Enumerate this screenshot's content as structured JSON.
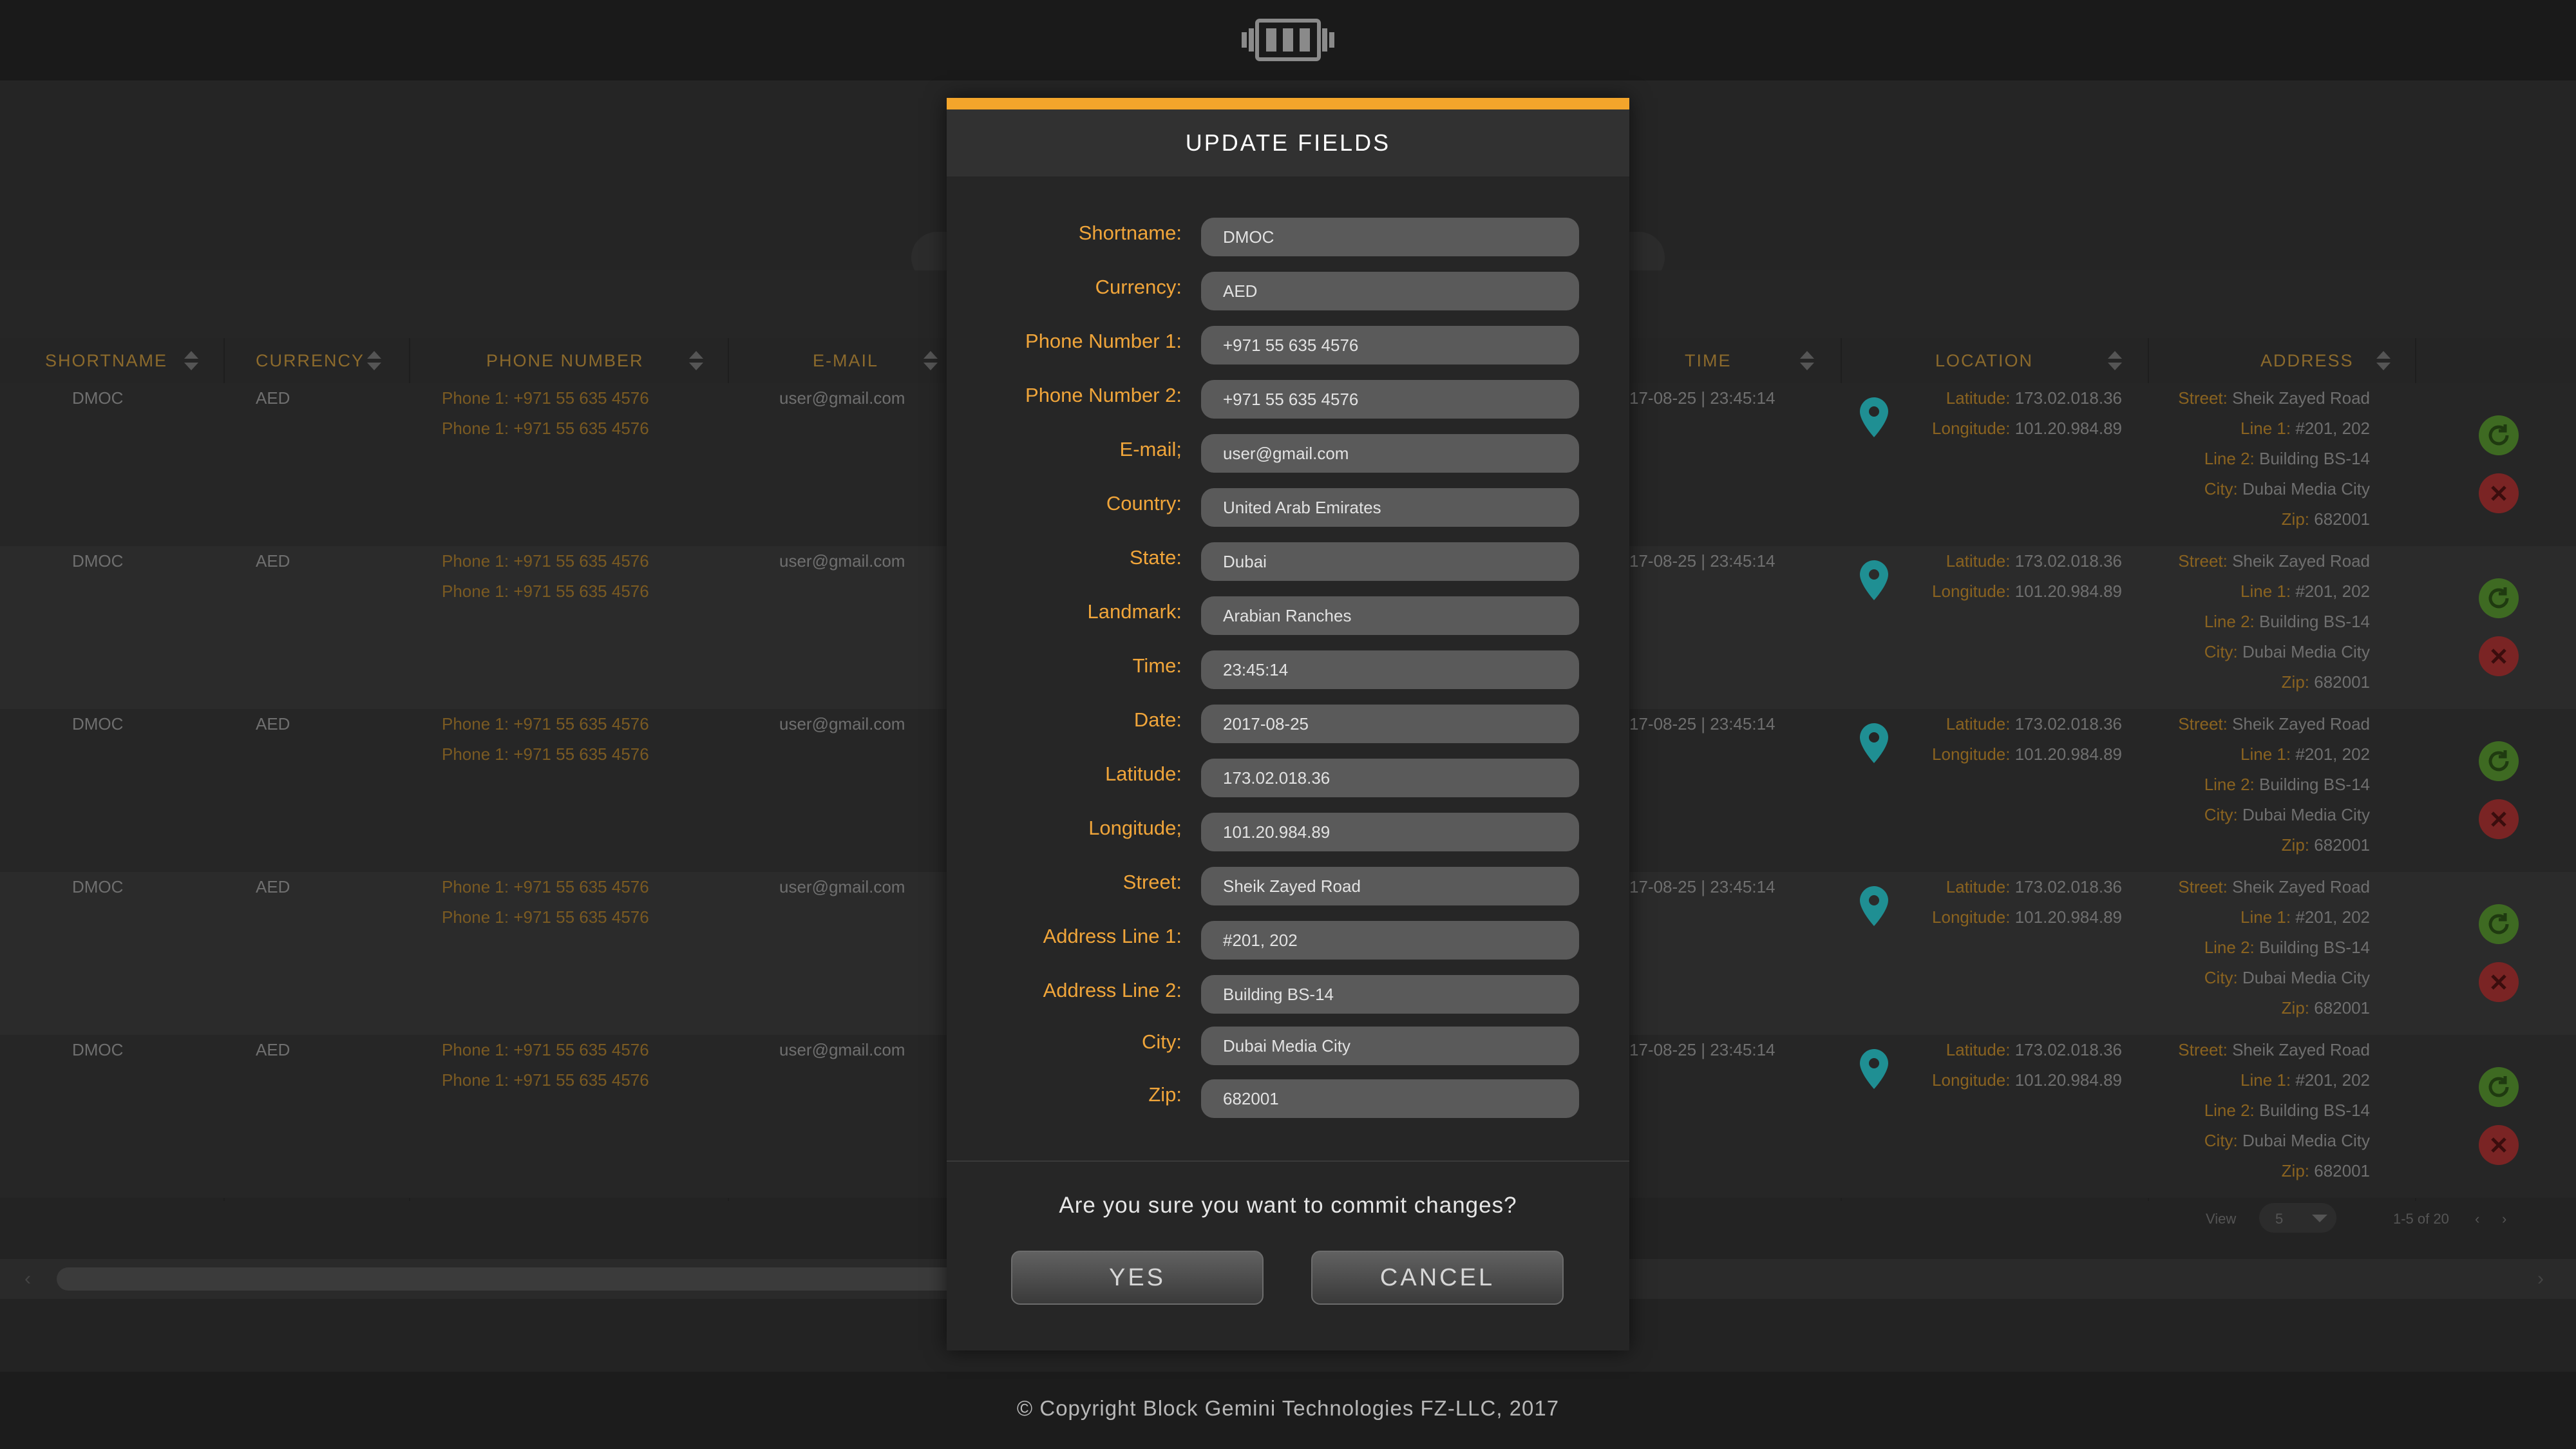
{
  "header": {
    "logo_icon": "block-gemini-logo-icon"
  },
  "table": {
    "columns": {
      "shortname": "SHORTNAME",
      "currency": "CURRENCY",
      "phone": "PHONE NUMBER",
      "email": "E-MAIL",
      "time": "TIME",
      "location": "LOCATION",
      "address": "ADDRESS"
    },
    "labels": {
      "phone1": "Phone 1:",
      "phone2": "Phone 1:",
      "latitude": "Latitude:",
      "longitude": "Longitude:",
      "street": "Street:",
      "line1": "Line 1:",
      "line2": "Line 2:",
      "city": "City:",
      "zip": "Zip:"
    },
    "rows": [
      {
        "shortname": "DMOC",
        "currency": "AED",
        "phone1": "+971 55 635 4576",
        "phone2": "+971 55 635 4576",
        "email": "user@gmail.com",
        "time": "17-08-25  |  23:45:14",
        "latitude": "173.02.018.36",
        "longitude": "101.20.984.89",
        "street": "Sheik Zayed Road",
        "line1": "#201, 202",
        "line2": "Building BS-14",
        "city": "Dubai Media City",
        "zip": "682001"
      },
      {
        "shortname": "DMOC",
        "currency": "AED",
        "phone1": "+971 55 635 4576",
        "phone2": "+971 55 635 4576",
        "email": "user@gmail.com",
        "time": "17-08-25  |  23:45:14",
        "latitude": "173.02.018.36",
        "longitude": "101.20.984.89",
        "street": "Sheik Zayed Road",
        "line1": "#201, 202",
        "line2": "Building BS-14",
        "city": "Dubai Media City",
        "zip": "682001"
      },
      {
        "shortname": "DMOC",
        "currency": "AED",
        "phone1": "+971 55 635 4576",
        "phone2": "+971 55 635 4576",
        "email": "user@gmail.com",
        "time": "17-08-25  |  23:45:14",
        "latitude": "173.02.018.36",
        "longitude": "101.20.984.89",
        "street": "Sheik Zayed Road",
        "line1": "#201, 202",
        "line2": "Building BS-14",
        "city": "Dubai Media City",
        "zip": "682001"
      },
      {
        "shortname": "DMOC",
        "currency": "AED",
        "phone1": "+971 55 635 4576",
        "phone2": "+971 55 635 4576",
        "email": "user@gmail.com",
        "time": "17-08-25  |  23:45:14",
        "latitude": "173.02.018.36",
        "longitude": "101.20.984.89",
        "street": "Sheik Zayed Road",
        "line1": "#201, 202",
        "line2": "Building BS-14",
        "city": "Dubai Media City",
        "zip": "682001"
      },
      {
        "shortname": "DMOC",
        "currency": "AED",
        "phone1": "+971 55 635 4576",
        "phone2": "+971 55 635 4576",
        "email": "user@gmail.com",
        "time": "17-08-25  |  23:45:14",
        "latitude": "173.02.018.36",
        "longitude": "101.20.984.89",
        "street": "Sheik Zayed Road",
        "line1": "#201, 202",
        "line2": "Building BS-14",
        "city": "Dubai Media City",
        "zip": "682001"
      }
    ]
  },
  "pagination": {
    "view_label": "View",
    "page_size": "5",
    "range": "1-5 of 20"
  },
  "modal": {
    "title": "UPDATE FIELDS",
    "fields": [
      {
        "label": "Shortname:",
        "value": "DMOC"
      },
      {
        "label": "Currency:",
        "value": "AED"
      },
      {
        "label": "Phone Number 1:",
        "value": "+971 55 635 4576"
      },
      {
        "label": "Phone Number 2:",
        "value": "+971 55 635 4576"
      },
      {
        "label": "E-mail;",
        "value": "user@gmail.com"
      },
      {
        "label": "Country:",
        "value": "United Arab Emirates"
      },
      {
        "label": "State:",
        "value": "Dubai"
      },
      {
        "label": "Landmark:",
        "value": "Arabian Ranches"
      },
      {
        "label": "Time:",
        "value": "23:45:14"
      },
      {
        "label": "Date:",
        "value": "2017-08-25"
      },
      {
        "label": "Latitude:",
        "value": "173.02.018.36"
      },
      {
        "label": "Longitude;",
        "value": "101.20.984.89"
      },
      {
        "label": "Street:",
        "value": "Sheik Zayed Road"
      },
      {
        "label": "Address Line 1:",
        "value": "#201, 202"
      },
      {
        "label": "Address Line 2:",
        "value": "Building BS-14"
      },
      {
        "label": "City:",
        "value": "Dubai Media City"
      },
      {
        "label": "Zip:",
        "value": "682001"
      }
    ],
    "confirm_text": "Are you sure you want to commit changes?",
    "yes_label": "YES",
    "cancel_label": "CANCEL"
  },
  "footer": {
    "copyright": "© Copyright Block Gemini Technologies FZ-LLC, 2017"
  },
  "colors": {
    "accent": "#f3a52b",
    "label": "#f0a53a",
    "pin": "#1f8f93",
    "refresh": "#3e6a22",
    "delete": "#7a2424"
  }
}
